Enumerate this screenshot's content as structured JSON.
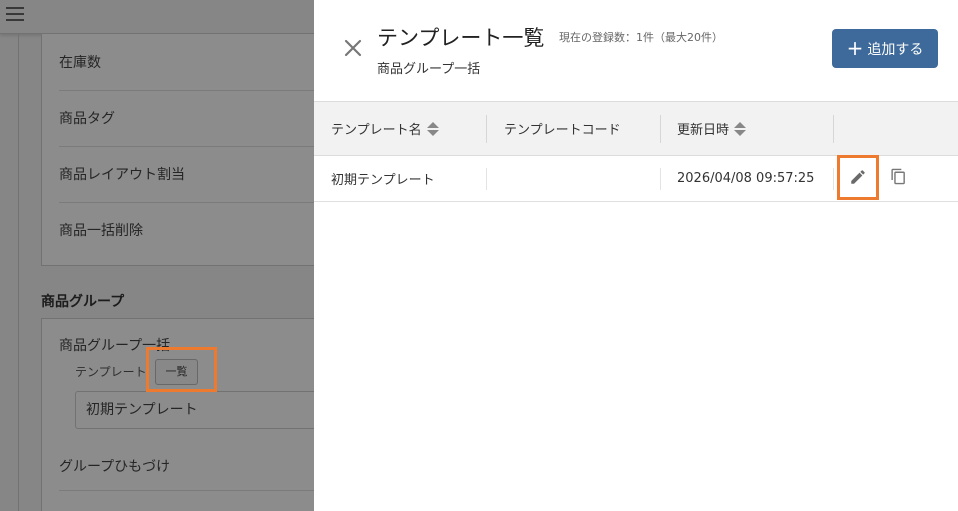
{
  "background": {
    "sections_top": [
      {
        "label": "在庫数"
      },
      {
        "label": "商品タグ"
      },
      {
        "label": "商品レイアウト割当"
      },
      {
        "label": "商品一括削除"
      }
    ],
    "group_section_title": "商品グループ",
    "group_bulk_title": "商品グループ一括",
    "template_label": "テンプレート",
    "list_button_label": "一覧",
    "template_select_value": "初期テンプレート",
    "group_link_label": "グループひもづけ"
  },
  "drawer": {
    "title": "テンプレート一覧",
    "count_text": "現在の登録数：1件（最大20件）",
    "subtitle": "商品グループ一括",
    "add_button_label": "追加する",
    "table": {
      "headers": [
        "テンプレート名",
        "テンプレートコード",
        "更新日時"
      ],
      "rows": [
        {
          "name": "初期テンプレート",
          "code": "",
          "updated_at": "2026/04/08 09:57:25"
        }
      ]
    }
  },
  "colors": {
    "accent": "#3d6a9a",
    "highlight": "#ee7a30",
    "overlay": "rgba(0,0,0,0.45)"
  },
  "icons": {
    "close": "close-icon",
    "add": "plus-icon",
    "sort": "sort-icon",
    "edit": "pencil-icon",
    "copy": "copy-icon",
    "menu": "hamburger-icon"
  }
}
